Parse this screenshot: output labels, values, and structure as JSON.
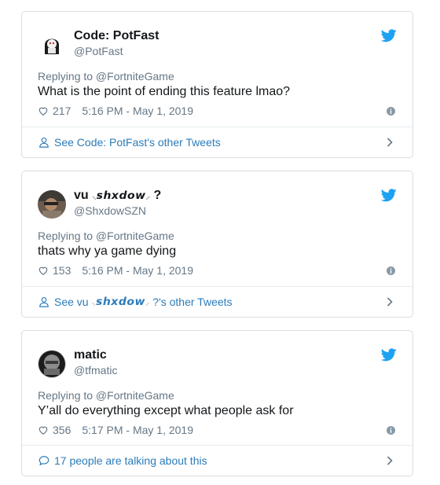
{
  "tweets": [
    {
      "name": "Code: PotFast",
      "handle": "@PotFast",
      "replying": "Replying to @FortniteGame",
      "text": "What is the point of ending this feature lmao?",
      "likes": "217",
      "time": "5:16 PM - May 1, 2019",
      "footer": "See Code: PotFast's other Tweets",
      "footer_icon": "person-icon"
    },
    {
      "name_prefix": "vu",
      "name_styled": "𝙨𝙝𝙭𝙙𝙤𝙬",
      "name_suffix": "?",
      "handle": "@ShxdowSZN",
      "replying": "Replying to @FortniteGame",
      "text": "thats why ya game dying",
      "likes": "153",
      "time": "5:16 PM - May 1, 2019",
      "footer_prefix": "See vu",
      "footer_styled": "𝙨𝙝𝙭𝙙𝙤𝙬",
      "footer_suffix": "?'s other Tweets",
      "footer_icon": "person-icon"
    },
    {
      "name": "matic",
      "handle": "@tfmatic",
      "replying": "Replying to @FortniteGame",
      "text": "Y’all do everything except what people ask for",
      "likes": "356",
      "time": "5:17 PM - May 1, 2019",
      "footer": "17 people are talking about this",
      "footer_icon": "speech-bubble-icon"
    }
  ],
  "colors": {
    "twitter_blue": "#1da1f2",
    "link": "#2b7bb9",
    "muted": "#657786",
    "border": "#d8dee3"
  }
}
